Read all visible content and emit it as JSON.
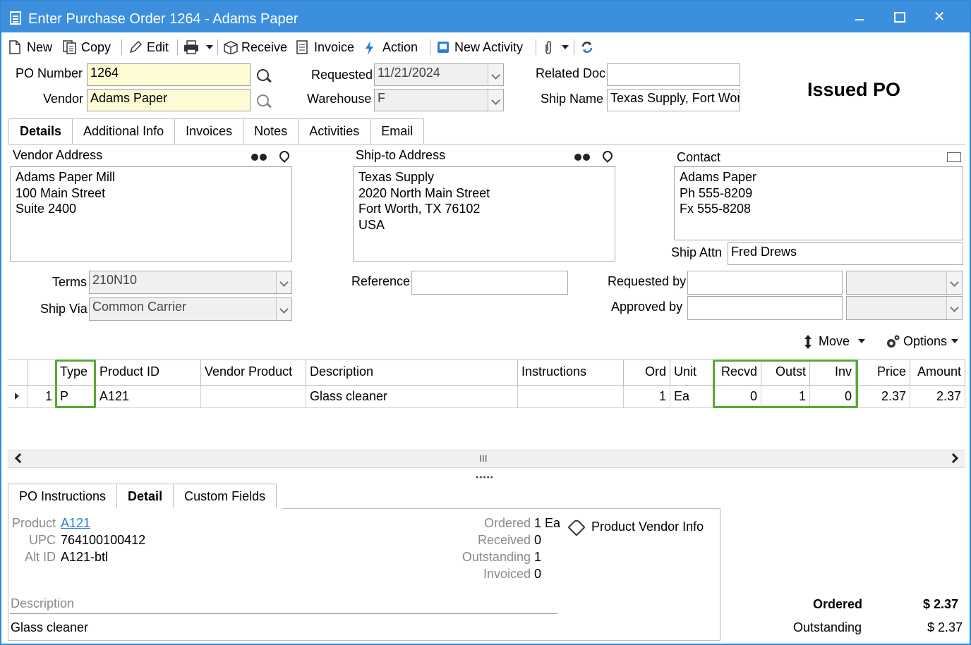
{
  "window": {
    "title": "Enter Purchase Order 1264 - Adams Paper"
  },
  "toolbar": {
    "new": "New",
    "copy": "Copy",
    "edit": "Edit",
    "receive": "Receive",
    "invoice": "Invoice",
    "action": "Action",
    "new_activity": "New Activity"
  },
  "header": {
    "po_number_label": "PO Number",
    "po_number": "1264",
    "vendor_label": "Vendor",
    "vendor": "Adams Paper",
    "requested_label": "Requested",
    "requested": "11/21/2024",
    "warehouse_label": "Warehouse",
    "warehouse": "F",
    "related_doc_label": "Related Doc",
    "related_doc": "",
    "ship_name_label": "Ship Name",
    "ship_name": "Texas Supply, Fort Wort",
    "status": "Issued PO"
  },
  "tabs": [
    "Details",
    "Additional Info",
    "Invoices",
    "Notes",
    "Activities",
    "Email"
  ],
  "details": {
    "vendor_address_label": "Vendor Address",
    "vendor_address": [
      "Adams Paper Mill",
      "100 Main Street",
      "Suite 2400"
    ],
    "shipto_address_label": "Ship-to Address",
    "shipto_address": [
      "Texas Supply",
      "2020 North Main Street",
      "Fort Worth, TX 76102",
      "USA"
    ],
    "contact_label": "Contact",
    "contact": [
      "Adams Paper",
      "Ph 555-8209",
      "Fx 555-8208"
    ],
    "ship_attn_label": "Ship Attn",
    "ship_attn": "Fred Drews",
    "terms_label": "Terms",
    "terms": "210N10",
    "ship_via_label": "Ship Via",
    "ship_via": "Common Carrier",
    "reference_label": "Reference",
    "reference": "",
    "requested_by_label": "Requested by",
    "approved_by_label": "Approved by",
    "move_label": "Move",
    "options_label": "Options"
  },
  "grid": {
    "columns": [
      "Type",
      "Product ID",
      "Vendor Product",
      "Description",
      "Instructions",
      "Ord",
      "Unit",
      "Recvd",
      "Outst",
      "Inv",
      "Price",
      "Amount"
    ],
    "rows": [
      {
        "line": "1",
        "type": "P",
        "product_id": "A121",
        "vendor_product": "",
        "description": "Glass cleaner",
        "instructions": "",
        "ord": "1",
        "unit": "Ea",
        "recvd": "0",
        "outst": "1",
        "inv": "0",
        "price": "2.37",
        "amount": "2.37"
      }
    ],
    "scroll_grip": "III"
  },
  "bottom_tabs": [
    "PO Instructions",
    "Detail",
    "Custom Fields"
  ],
  "detail": {
    "product_label": "Product",
    "product": "A121",
    "upc_label": "UPC",
    "upc": "764100100412",
    "altid_label": "Alt ID",
    "altid": "A121-btl",
    "ordered_label": "Ordered",
    "ordered": "1 Ea",
    "received_label": "Received",
    "received": "0",
    "outstanding_label": "Outstanding",
    "outstanding": "1",
    "invoiced_label": "Invoiced",
    "invoiced": "0",
    "product_vendor_info": "Product Vendor Info",
    "description_label": "Description",
    "description": "Glass cleaner"
  },
  "totals": {
    "ordered_label": "Ordered",
    "ordered": "$ 2.37",
    "outstanding_label": "Outstanding",
    "outstanding": "$ 2.37"
  }
}
